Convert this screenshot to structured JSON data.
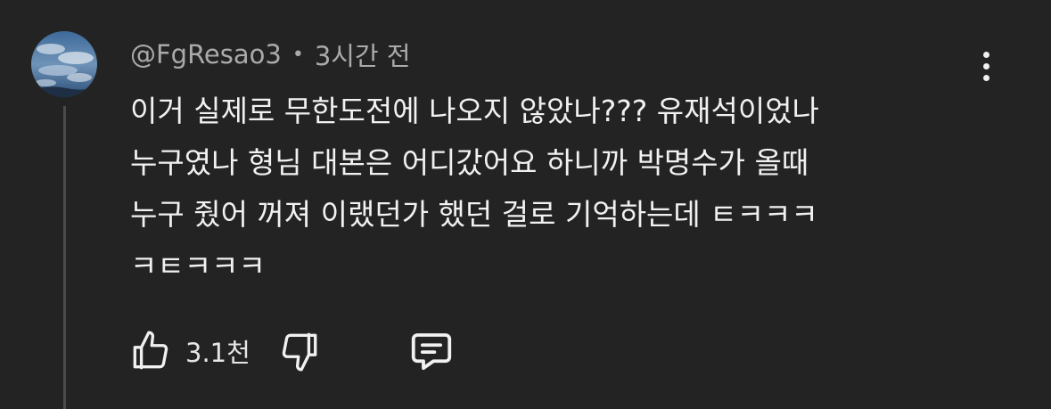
{
  "comment": {
    "author": "@FgResao3",
    "separator": "•",
    "time_ago": "3시간 전",
    "text_lines": [
      "이거 실제로 무한도전에 나오지 않았나??? 유재석이었나",
      "누구였나 형님 대본은 어디갔어요 하니까 박명수가 올때",
      "누구 줬어 꺼져 이랬던가 했던 걸로 기억하는데 ㅌㅋㅋㅋ",
      "ㅋㅌㅋㅋㅋ"
    ],
    "like_count": "3.1천"
  },
  "icons": {
    "avatar": "avatar-image",
    "more": "more-vert-icon",
    "like": "thumbs-up-icon",
    "dislike": "thumbs-down-icon",
    "reply": "reply-comment-icon"
  },
  "colors": {
    "background": "#232323",
    "text_primary": "#f1f1f1",
    "text_secondary": "#aaaaaa",
    "thread_line": "#4a4a4a"
  }
}
